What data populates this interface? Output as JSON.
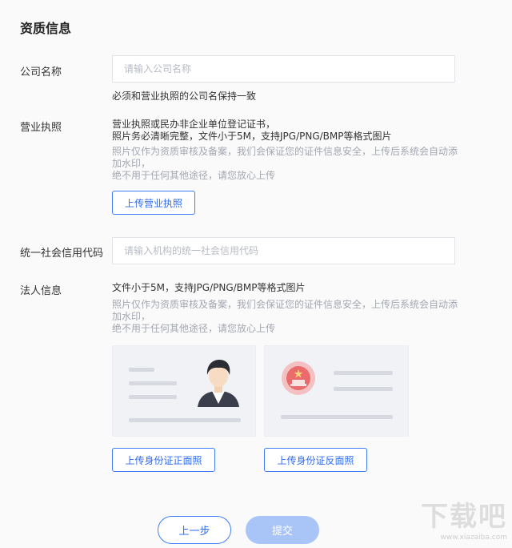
{
  "section_title": "资质信息",
  "company": {
    "label": "公司名称",
    "placeholder": "请输入公司名称",
    "hint": "必须和营业执照的公司名保持一致"
  },
  "license": {
    "label": "营业执照",
    "desc_line1": "营业执照或民办非企业单位登记证书，",
    "desc_line2": "照片务必清晰完整，文件小于5M，支持JPG/PNG/BMP等格式图片",
    "note_line1": "照片仅作为资质审核及备案，我们会保证您的证件信息安全，上传后系统会自动添",
    "note_line2": "加水印，",
    "note_line3": "绝不用于任何其他途径，请您放心上传",
    "upload_button": "上传营业执照"
  },
  "credit_code": {
    "label": "统一社会信用代码",
    "placeholder": "请输入机构的统一社会信用代码"
  },
  "legal_person": {
    "label": "法人信息",
    "desc": "文件小于5M，支持JPG/PNG/BMP等格式图片",
    "note_line1": "照片仅作为资质审核及备案，我们会保证您的证件信息安全，上传后系统会自动添",
    "note_line2": "加水印，",
    "note_line3": "绝不用于任何其他途径，请您放心上传",
    "front_button": "上传身份证正面照",
    "back_button": "上传身份证反面照"
  },
  "footer": {
    "prev_button": "上一步",
    "submit_button": "提交"
  },
  "watermark": {
    "text": "下载吧",
    "url": "www.xiazaiba.com"
  },
  "colors": {
    "accent": "#2f6cf0",
    "submit_disabled": "#a9c4f7"
  },
  "icons": [
    "avatar-illustration",
    "national-emblem-icon"
  ]
}
